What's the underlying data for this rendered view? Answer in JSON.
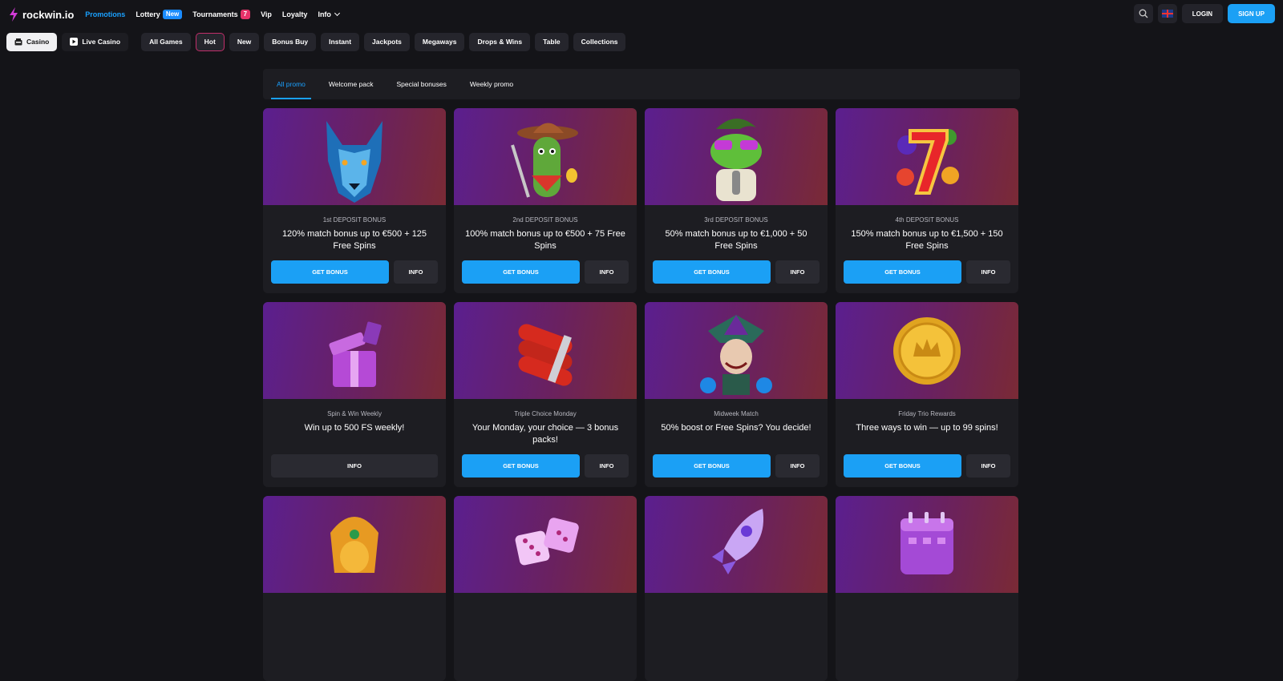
{
  "brand": {
    "name": "rockwin.io"
  },
  "nav": {
    "items": [
      {
        "label": "Promotions",
        "active": true
      },
      {
        "label": "Lottery",
        "badge": "New"
      },
      {
        "label": "Tournaments",
        "badge": "7"
      },
      {
        "label": "Vip"
      },
      {
        "label": "Loyalty"
      },
      {
        "label": "Info"
      }
    ]
  },
  "header": {
    "login_label": "LOGIN",
    "signup_label": "SIGN UP",
    "search_icon": "search-icon",
    "language_icon": "uk-flag-icon"
  },
  "categories": [
    {
      "label": "Casino",
      "icon": "casino-icon"
    },
    {
      "label": "Live Casino",
      "icon": "play-icon"
    },
    {
      "label": "All Games"
    },
    {
      "label": "Hot"
    },
    {
      "label": "New"
    },
    {
      "label": "Bonus Buy"
    },
    {
      "label": "Instant"
    },
    {
      "label": "Jackpots"
    },
    {
      "label": "Megaways"
    },
    {
      "label": "Drops & Wins"
    },
    {
      "label": "Table"
    },
    {
      "label": "Collections"
    }
  ],
  "promo_tabs": [
    {
      "label": "All promo",
      "active": true
    },
    {
      "label": "Welcome pack"
    },
    {
      "label": "Special bonuses"
    },
    {
      "label": "Weekly promo"
    }
  ],
  "buttons": {
    "get_bonus": "GET BONUS",
    "info": "INFO"
  },
  "cards": [
    {
      "image": "wolf",
      "subtitle": "1st DEPOSIT BONUS",
      "title": "120% match bonus up to €500 + 125 Free Spins"
    },
    {
      "image": "cactus-cowboy",
      "subtitle": "2nd DEPOSIT BONUS",
      "title": "100% match bonus up to €500 + 75 Free Spins"
    },
    {
      "image": "frog-singer",
      "subtitle": "3rd DEPOSIT BONUS",
      "title": "50% match bonus up to €1,000 + 50 Free Spins"
    },
    {
      "image": "lucky-seven",
      "subtitle": "4th DEPOSIT BONUS",
      "title": "150% match bonus up to €1,500 + 150 Free Spins"
    },
    {
      "image": "gift-box",
      "subtitle": "Spin & Win Weekly",
      "title": "Win up to 500 FS weekly!"
    },
    {
      "image": "dynamite",
      "subtitle": "Triple Choice Monday",
      "title": "Your Monday, your choice — 3 bonus packs!"
    },
    {
      "image": "jester",
      "subtitle": "Midweek Match",
      "title": "50% boost or Free Spins? You decide!"
    },
    {
      "image": "gold-coin",
      "subtitle": "Friday Trio Rewards",
      "title": "Three ways to win — up to 99 spins!"
    },
    {
      "image": "elephant-idol"
    },
    {
      "image": "dice"
    },
    {
      "image": "rocket"
    },
    {
      "image": "calendar"
    }
  ]
}
